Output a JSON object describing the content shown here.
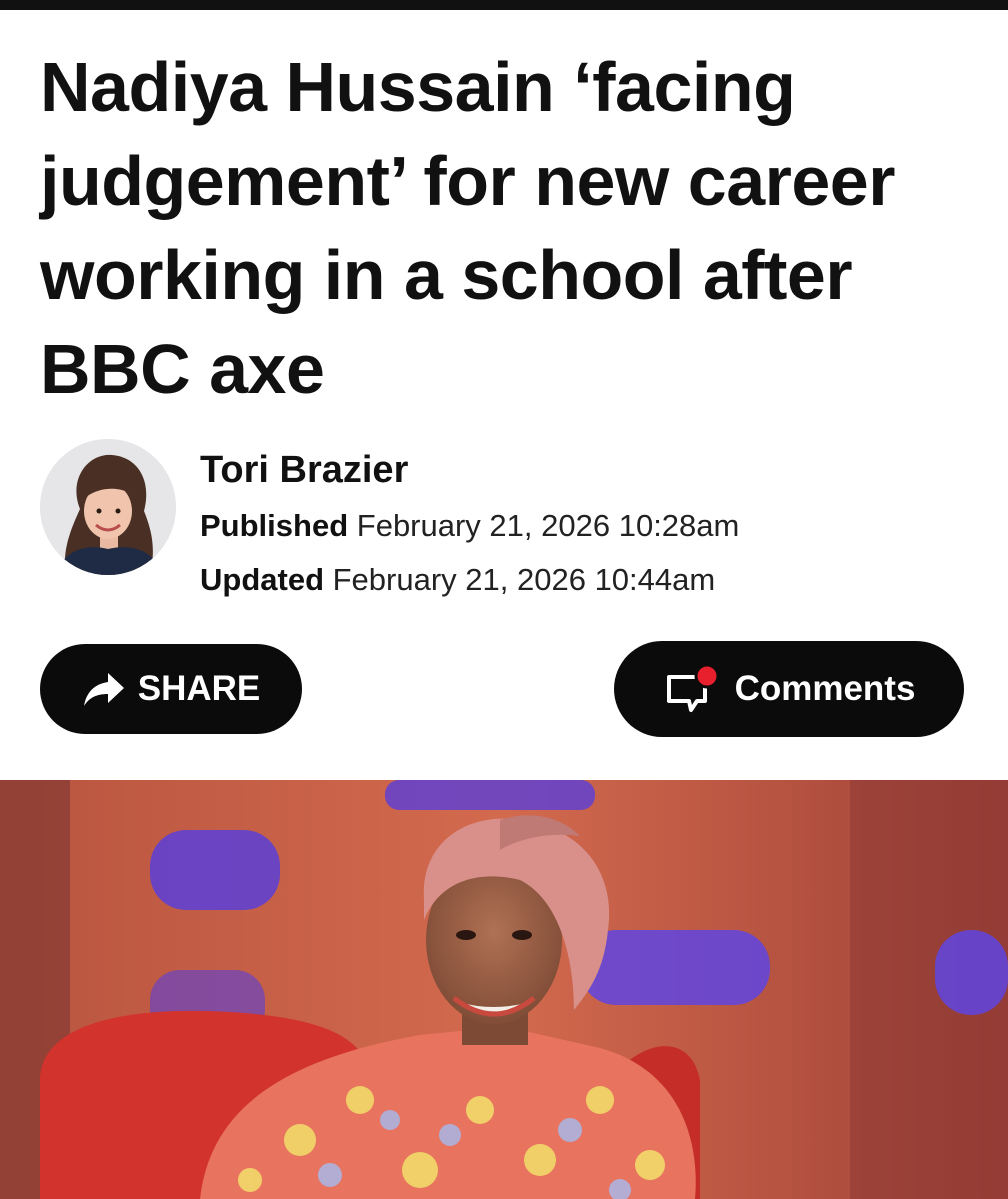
{
  "article": {
    "headline": "Nadiya Hussain ‘facing judgement’ for new career working in a school after BBC axe",
    "author": {
      "name": "Tori Brazier",
      "published_label": "Published",
      "published_value": "February 21, 2026 10:28am",
      "updated_label": "Updated",
      "updated_value": "February 21, 2026 10:44am"
    }
  },
  "actions": {
    "share_label": "SHARE",
    "comments_label": "Comments"
  },
  "icons": {
    "share": "share-arrow-icon",
    "comments": "comment-bubble-icon",
    "notification_dot": "notification-dot"
  },
  "colors": {
    "text": "#111111",
    "pill_background": "#0b0b0b",
    "notification_dot": "#e8202e",
    "top_bar": "#111111"
  }
}
